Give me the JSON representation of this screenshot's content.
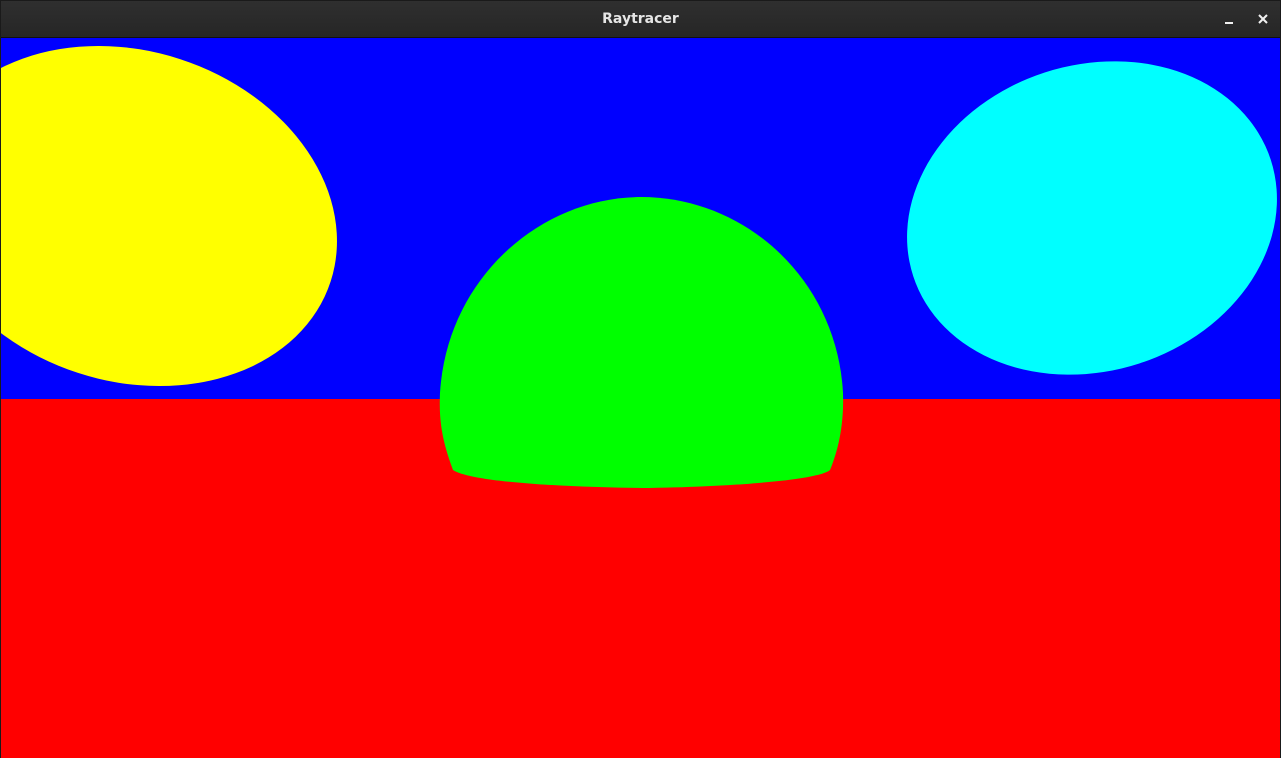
{
  "window": {
    "title": "Raytracer"
  },
  "scene": {
    "sky_color": "#0000FF",
    "ground_color": "#FF0000",
    "spheres": [
      {
        "name": "yellow-sphere",
        "color": "#FFFF00"
      },
      {
        "name": "green-sphere",
        "color": "#00FF00"
      },
      {
        "name": "cyan-sphere",
        "color": "#00FFFF"
      }
    ]
  },
  "icons": {
    "minimize": "minimize-icon",
    "close": "close-icon"
  }
}
